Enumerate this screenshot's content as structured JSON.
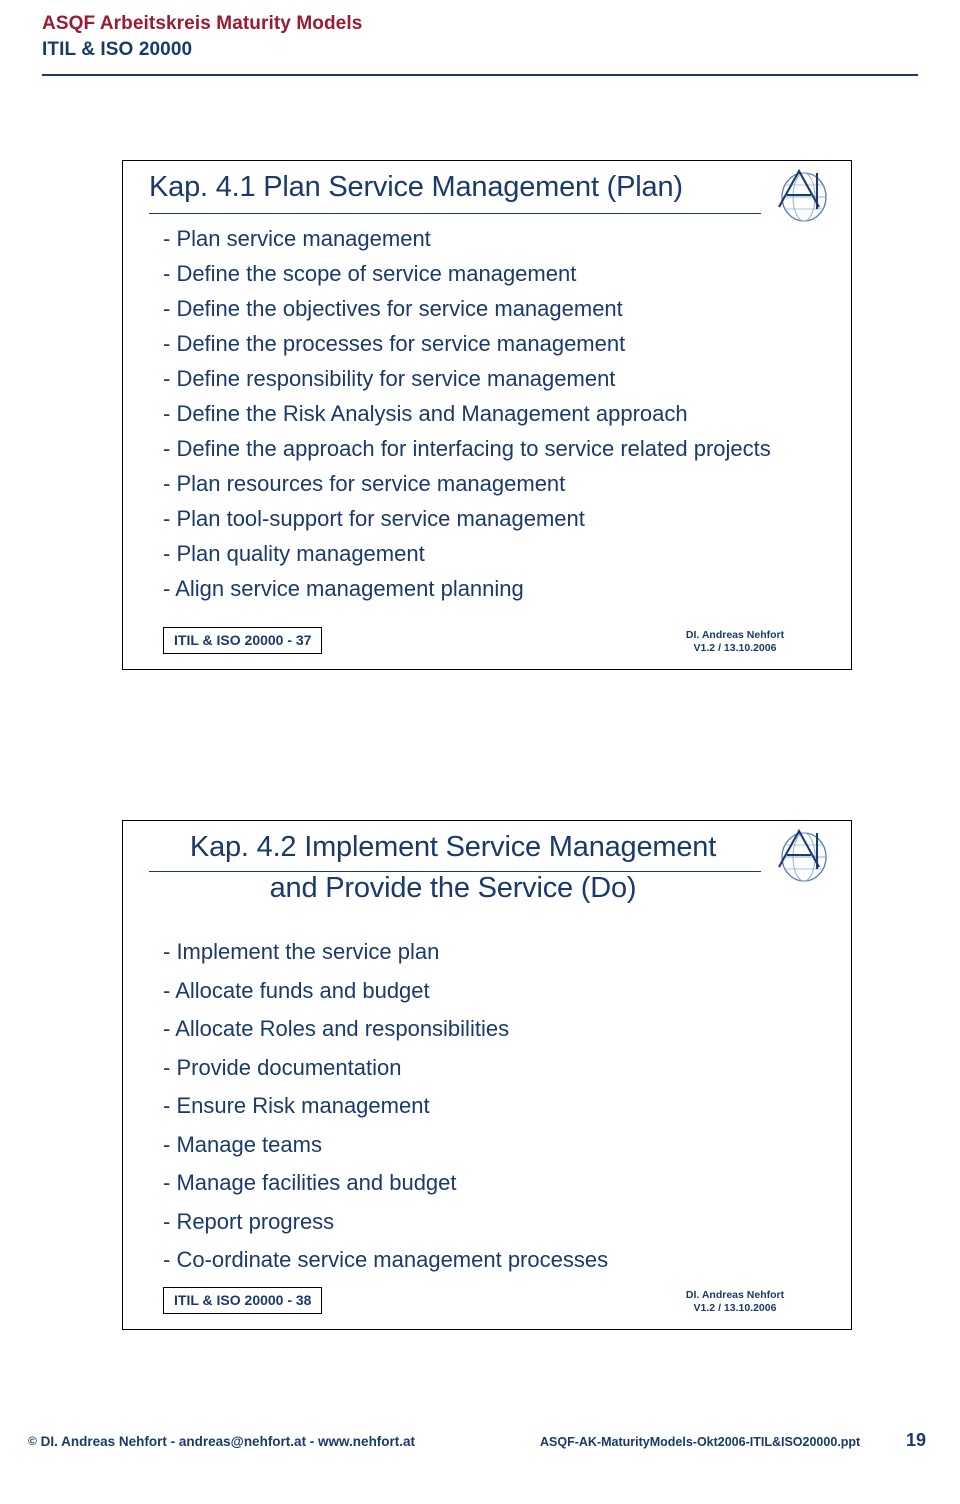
{
  "header": {
    "line1": "ASQF Arbeitskreis Maturity Models",
    "line2": "ITIL & ISO 20000"
  },
  "slides": [
    {
      "title": "Kap. 4.1 Plan Service Management (Plan)",
      "bullets": [
        "- Plan service management",
        "- Define the scope of service management",
        "- Define the objectives for service management",
        "- Define the processes for service management",
        "- Define responsibility for service management",
        "- Define the Risk Analysis and Management approach",
        "- Define the approach for interfacing to service related projects",
        "- Plan resources for service management",
        "- Plan tool-support for service management",
        "- Plan quality management",
        "- Align service management planning"
      ],
      "footer_label": "ITIL & ISO 20000 - 37",
      "author_line1": "DI. Andreas Nehfort",
      "author_line2": "V1.2  /  13.10.2006",
      "logo_name": "asqf-logo"
    },
    {
      "title_line1": "Kap. 4.2 Implement Service Management",
      "title_line2": "and Provide the Service (Do)",
      "bullets": [
        "- Implement the service plan",
        "- Allocate funds and budget",
        "- Allocate Roles and responsibilities",
        "- Provide documentation",
        "- Ensure Risk management",
        "- Manage teams",
        "- Manage facilities and budget",
        "- Report progress",
        "- Co-ordinate service management processes"
      ],
      "footer_label": "ITIL & ISO 20000 - 38",
      "author_line1": "DI. Andreas Nehfort",
      "author_line2": "V1.2  /  13.10.2006",
      "logo_name": "asqf-logo"
    }
  ],
  "footer": {
    "copyright_symbol": "©",
    "left": "DI. Andreas Nehfort  -  andreas@nehfort.at  -  www.nehfort.at",
    "center": "ASQF-AK-MaturityModels-Okt2006-ITIL&ISO20000.ppt",
    "page": "19"
  },
  "colors": {
    "accent_red": "#9c1b30",
    "primary_blue": "#1a3a6b"
  }
}
